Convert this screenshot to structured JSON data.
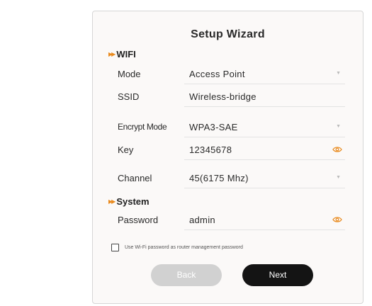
{
  "wizard": {
    "title": "Setup Wizard",
    "wifi_section": "WIFI",
    "system_section": "System",
    "fields": {
      "mode": {
        "label": "Mode",
        "value": "Access Point"
      },
      "ssid": {
        "label": "SSID",
        "value": "Wireless-bridge"
      },
      "encrypt_mode": {
        "label": "Encrypt Mode",
        "value": "WPA3-SAE"
      },
      "key": {
        "label": "Key",
        "value": "12345678"
      },
      "channel": {
        "label": "Channel",
        "value": "45(6175 Mhz)"
      },
      "password": {
        "label": "Password",
        "value": "admin"
      }
    },
    "use_wifi_password_label": "Use Wi-Fi password as router management password",
    "use_wifi_password_checked": false,
    "back_label": "Back",
    "next_label": "Next"
  },
  "icons": {
    "section_marker": "double-chevron-right-icon",
    "dropdown": "caret-down-icon",
    "reveal": "eye-icon"
  },
  "colors": {
    "accent": "#e98b1f",
    "next_button": "#141414",
    "back_button": "#d1d1d1"
  }
}
